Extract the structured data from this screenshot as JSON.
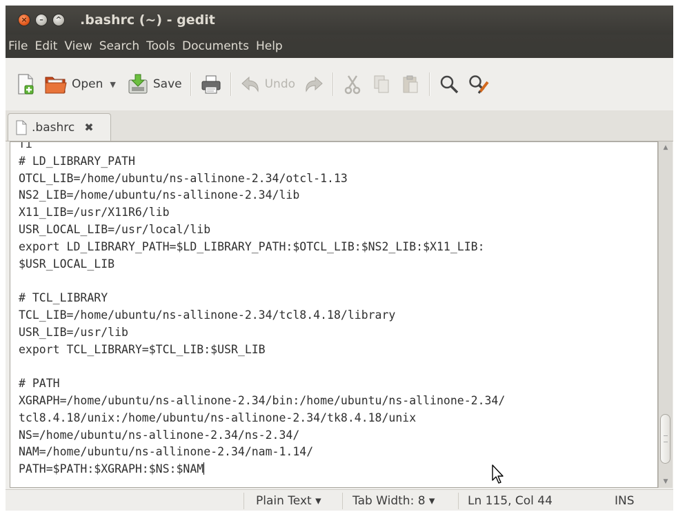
{
  "window": {
    "title": ".bashrc (~) - gedit",
    "buttons": [
      "close",
      "minimize",
      "maximize"
    ]
  },
  "menubar": {
    "items": [
      "File",
      "Edit",
      "View",
      "Search",
      "Tools",
      "Documents",
      "Help"
    ]
  },
  "toolbar": {
    "new_icon": "new-document-icon",
    "open_label": "Open",
    "save_label": "Save",
    "undo_label": "Undo",
    "print_icon": "print-icon",
    "redo_icon": "redo-icon",
    "cut_icon": "cut-icon",
    "copy_icon": "copy-icon",
    "paste_icon": "paste-icon",
    "find_icon": "search-icon",
    "replace_icon": "find-replace-icon"
  },
  "tab": {
    "label": ".bashrc",
    "close_glyph": "✖"
  },
  "editor": {
    "lines": [
      "fi",
      "# LD_LIBRARY_PATH",
      "OTCL_LIB=/home/ubuntu/ns-allinone-2.34/otcl-1.13",
      "NS2_LIB=/home/ubuntu/ns-allinone-2.34/lib",
      "X11_LIB=/usr/X11R6/lib",
      "USR_LOCAL_LIB=/usr/local/lib",
      "export LD_LIBRARY_PATH=$LD_LIBRARY_PATH:$OTCL_LIB:$NS2_LIB:$X11_LIB:",
      "$USR_LOCAL_LIB",
      "",
      "# TCL_LIBRARY",
      "TCL_LIB=/home/ubuntu/ns-allinone-2.34/tcl8.4.18/library",
      "USR_LIB=/usr/lib",
      "export TCL_LIBRARY=$TCL_LIB:$USR_LIB",
      "",
      "# PATH",
      "XGRAPH=/home/ubuntu/ns-allinone-2.34/bin:/home/ubuntu/ns-allinone-2.34/",
      "tcl8.4.18/unix:/home/ubuntu/ns-allinone-2.34/tk8.4.18/unix",
      "NS=/home/ubuntu/ns-allinone-2.34/ns-2.34/",
      "NAM=/home/ubuntu/ns-allinone-2.34/nam-1.14/",
      "PATH=$PATH:$XGRAPH:$NS:$NAM"
    ],
    "cursor_line": 19
  },
  "statusbar": {
    "language": "Plain Text ▾",
    "tab_width": "Tab Width: 8 ▾",
    "position": "Ln 115, Col 44",
    "mode": "INS"
  },
  "colors": {
    "titlebar": "#3c3b37",
    "title_text": "#dfdbd2",
    "window_bg": "#efeeeb"
  }
}
